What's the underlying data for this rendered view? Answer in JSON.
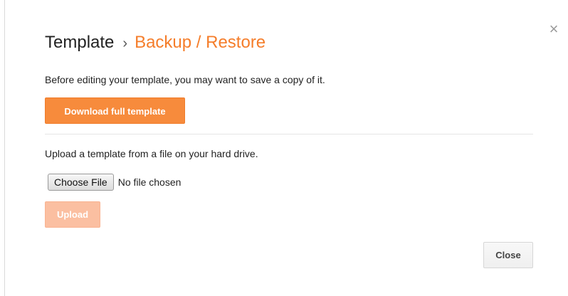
{
  "dialog": {
    "close_icon": "×",
    "title": {
      "crumb": "Template",
      "separator": "›",
      "current": "Backup / Restore"
    },
    "backup": {
      "description": "Before editing your template, you may want to save a copy of it.",
      "download_label": "Download full template"
    },
    "restore": {
      "description": "Upload a template from a file on your hard drive.",
      "choose_file_label": "Choose File",
      "file_status": "No file chosen",
      "upload_label": "Upload"
    },
    "close_label": "Close"
  },
  "colors": {
    "accent": "#f57d2a",
    "download_button": "#f78b3c",
    "upload_button_disabled": "#fbbfa1"
  }
}
